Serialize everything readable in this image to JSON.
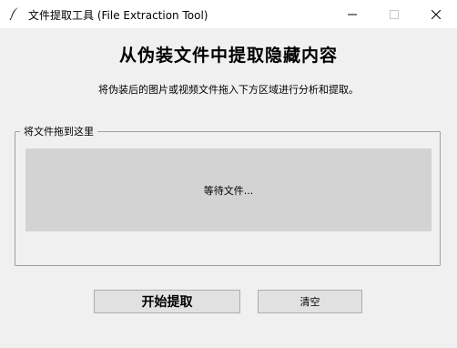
{
  "window": {
    "title": "文件提取工具 (File Extraction Tool)",
    "icon": "feather-icon"
  },
  "header": {
    "title": "从伪装文件中提取隐藏内容",
    "subtitle": "将伪装后的图片或视频文件拖入下方区域进行分析和提取。"
  },
  "drop_zone": {
    "group_label": "将文件拖到这里",
    "status": "等待文件..."
  },
  "buttons": {
    "start_label": "开始提取",
    "clear_label": "清空"
  },
  "colors": {
    "background": "#f0f0f0",
    "drop_area": "#d3d3d3",
    "button": "#e1e1e1"
  }
}
